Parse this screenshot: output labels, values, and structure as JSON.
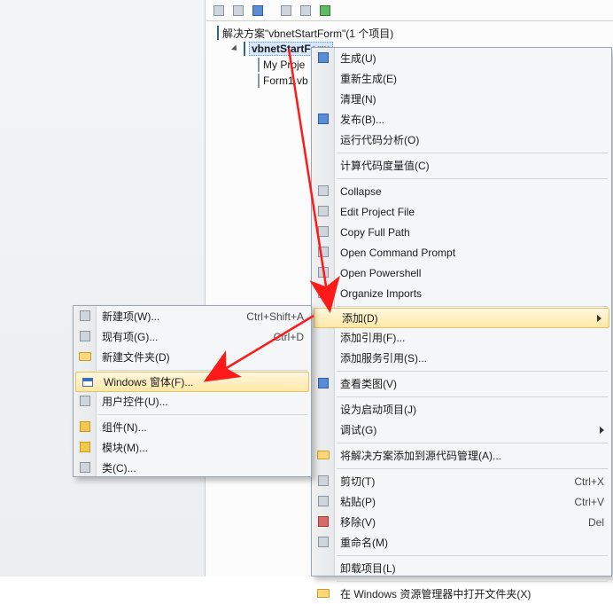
{
  "toolbar_icons": [
    "copy-icon",
    "properties-icon",
    "refresh-icon",
    "search-icon",
    "wrench-icon",
    "show-all-icon"
  ],
  "solution": {
    "label": "解决方案\"vbnetStartForm\"(1 个项目)",
    "project": "vbnetStartForm",
    "items": [
      "My Proje",
      "Form1.vb"
    ]
  },
  "context_menu_right": {
    "groups": [
      [
        {
          "id": "build",
          "label": "生成(U)",
          "icon": "build-icon"
        },
        {
          "id": "rebuild",
          "label": "重新生成(E)"
        },
        {
          "id": "clean",
          "label": "清理(N)"
        },
        {
          "id": "publish",
          "label": "发布(B)...",
          "icon": "publish-icon"
        },
        {
          "id": "analyze",
          "label": "运行代码分析(O)"
        }
      ],
      [
        {
          "id": "metrics",
          "label": "计算代码度量值(C)"
        }
      ],
      [
        {
          "id": "collapse",
          "label": "Collapse",
          "icon": "collapse-icon"
        },
        {
          "id": "editproj",
          "label": "Edit Project File",
          "icon": "edit-icon"
        },
        {
          "id": "copypath",
          "label": "Copy Full Path",
          "icon": "copy-icon"
        },
        {
          "id": "cmd",
          "label": "Open Command Prompt",
          "icon": "cmd-icon"
        },
        {
          "id": "ps",
          "label": "Open Powershell",
          "icon": "ps-icon"
        },
        {
          "id": "org",
          "label": "Organize Imports",
          "icon": "org-icon"
        }
      ],
      [
        {
          "id": "add",
          "label": "添加(D)",
          "highlight": true,
          "submenu": true
        },
        {
          "id": "addref",
          "label": "添加引用(F)..."
        },
        {
          "id": "addsvc",
          "label": "添加服务引用(S)..."
        }
      ],
      [
        {
          "id": "classview",
          "label": "查看类图(V)",
          "icon": "classview-icon"
        }
      ],
      [
        {
          "id": "startup",
          "label": "设为启动项目(J)"
        },
        {
          "id": "debug",
          "label": "调试(G)",
          "submenu": true
        }
      ],
      [
        {
          "id": "scc",
          "label": "将解决方案添加到源代码管理(A)...",
          "icon": "scc-icon"
        }
      ],
      [
        {
          "id": "cut",
          "label": "剪切(T)",
          "shortcut": "Ctrl+X",
          "icon": "cut-icon"
        },
        {
          "id": "paste",
          "label": "粘贴(P)",
          "shortcut": "Ctrl+V",
          "icon": "paste-icon"
        },
        {
          "id": "delete",
          "label": "移除(V)",
          "shortcut": "Del",
          "icon": "delete-icon"
        },
        {
          "id": "rename",
          "label": "重命名(M)",
          "icon": "rename-icon"
        }
      ],
      [
        {
          "id": "unload",
          "label": "卸载项目(L)"
        }
      ],
      [
        {
          "id": "openinexp",
          "label": "在 Windows 资源管理器中打开文件夹(X)",
          "icon": "folder-icon"
        }
      ]
    ]
  },
  "context_menu_left": {
    "groups": [
      [
        {
          "id": "newitem",
          "label": "新建项(W)...",
          "shortcut": "Ctrl+Shift+A",
          "icon": "newitem-icon"
        },
        {
          "id": "existitem",
          "label": "现有项(G)...",
          "shortcut": "Ctrl+D",
          "icon": "existitem-icon"
        },
        {
          "id": "newfolder",
          "label": "新建文件夹(D)",
          "icon": "newfolder-icon"
        }
      ],
      [
        {
          "id": "winform",
          "label": "Windows 窗体(F)...",
          "highlight": true,
          "icon": "form-icon"
        },
        {
          "id": "usercontrol",
          "label": "用户控件(U)...",
          "icon": "usercontrol-icon"
        }
      ],
      [
        {
          "id": "component",
          "label": "组件(N)...",
          "icon": "component-icon"
        },
        {
          "id": "module",
          "label": "模块(M)...",
          "icon": "module-icon"
        },
        {
          "id": "class",
          "label": "类(C)...",
          "icon": "class-icon"
        }
      ]
    ]
  }
}
